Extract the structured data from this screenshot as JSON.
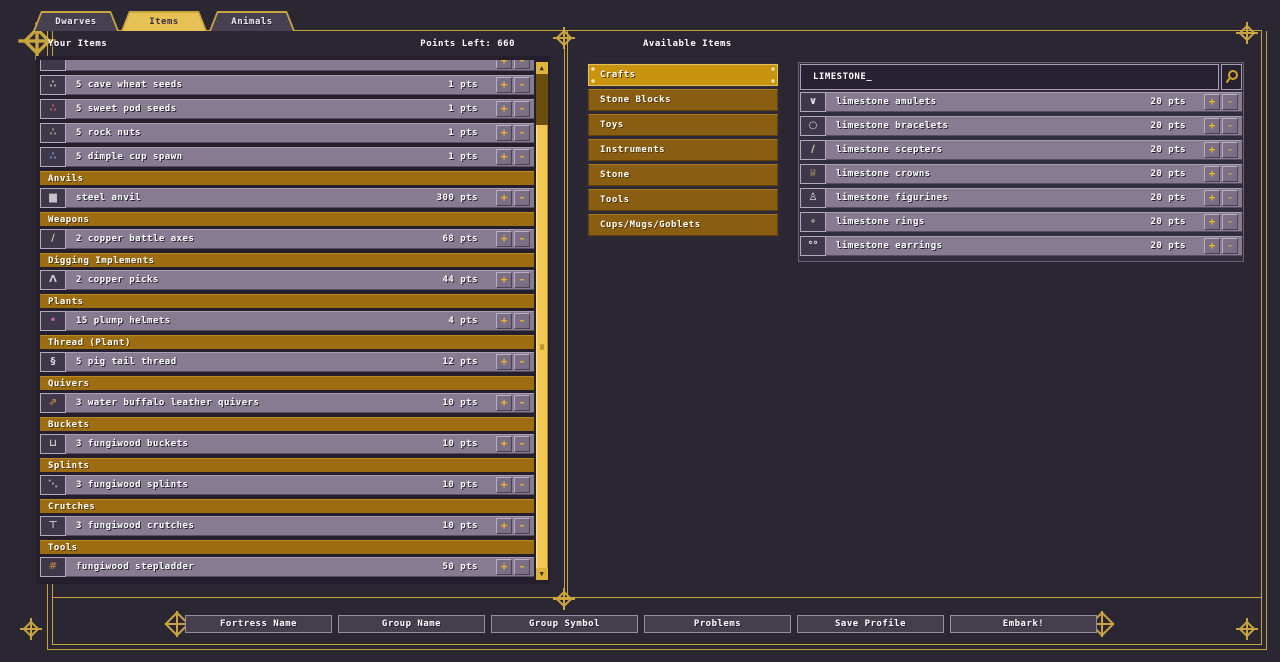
{
  "window": {
    "tabs": [
      {
        "label": "Dwarves",
        "active": false
      },
      {
        "label": "Items",
        "active": true
      },
      {
        "label": "Animals",
        "active": false
      }
    ]
  },
  "controls": {
    "increase_label": "+",
    "decrease_label": "-",
    "scroll_up": "▲",
    "scroll_down": "▼",
    "scroll_grip": "≡"
  },
  "colors": {
    "gold_frame": "#c9a540",
    "tab_active": "#e6c257",
    "section_header": "#9c6d11",
    "category": "#8a5e12",
    "category_selected": "#c8930e",
    "row": "#877b91",
    "button_glyph": "#f2b32c",
    "scroll_thumb": "#f0c853",
    "background": "#2b2732"
  },
  "left_panel": {
    "title": "Your Items",
    "points_left": "Points Left: 660",
    "list": [
      {
        "type": "item",
        "partial": true,
        "name": "",
        "pts": "",
        "icon": "",
        "icon_color": "#3f384a",
        "icon_name": "item-icon"
      },
      {
        "type": "item",
        "name": "5 cave wheat seeds",
        "pts": "1 pts",
        "icon": "∴",
        "icon_color": "#b9b1a4",
        "icon_name": "seeds-icon"
      },
      {
        "type": "item",
        "name": "5 sweet pod seeds",
        "pts": "1 pts",
        "icon": "∴",
        "icon_color": "#c25f5f",
        "icon_name": "seeds-icon"
      },
      {
        "type": "item",
        "name": "5 rock nuts",
        "pts": "1 pts",
        "icon": "∴",
        "icon_color": "#9aa37a",
        "icon_name": "seeds-icon"
      },
      {
        "type": "item",
        "name": "5 dimple cup spawn",
        "pts": "1 pts",
        "icon": "∴",
        "icon_color": "#6f8fd6",
        "icon_name": "spawn-icon"
      },
      {
        "type": "header",
        "label": "Anvils"
      },
      {
        "type": "item",
        "name": "steel anvil",
        "pts": "300 pts",
        "icon": "▆",
        "icon_color": "#c6c1cb",
        "icon_name": "anvil-icon"
      },
      {
        "type": "header",
        "label": "Weapons"
      },
      {
        "type": "item",
        "name": "2 copper battle axes",
        "pts": "68 pts",
        "icon": "∕",
        "icon_color": "#d8c49a",
        "icon_name": "battle-axe-icon"
      },
      {
        "type": "header",
        "label": "Digging Implements"
      },
      {
        "type": "item",
        "name": "2 copper picks",
        "pts": "44 pts",
        "icon": "Λ",
        "icon_color": "#cfc8d6",
        "icon_name": "pick-icon"
      },
      {
        "type": "header",
        "label": "Plants"
      },
      {
        "type": "item",
        "name": "15 plump helmets",
        "pts": "4 pts",
        "icon": "•",
        "icon_color": "#c964ba",
        "icon_name": "plump-helmet-icon"
      },
      {
        "type": "header",
        "label": "Thread (Plant)"
      },
      {
        "type": "item",
        "name": "5 pig tail thread",
        "pts": "12 pts",
        "icon": "§",
        "icon_color": "#dcd8e2",
        "icon_name": "thread-icon"
      },
      {
        "type": "header",
        "label": "Quivers"
      },
      {
        "type": "item",
        "name": "3 water buffalo leather quivers",
        "pts": "10 pts",
        "icon": "⇗",
        "icon_color": "#c08a4a",
        "icon_name": "quiver-icon"
      },
      {
        "type": "header",
        "label": "Buckets"
      },
      {
        "type": "item",
        "name": "3 fungiwood buckets",
        "pts": "10 pts",
        "icon": "⊔",
        "icon_color": "#d2cbb9",
        "icon_name": "bucket-icon"
      },
      {
        "type": "header",
        "label": "Splints"
      },
      {
        "type": "item",
        "name": "3 fungiwood splints",
        "pts": "10 pts",
        "icon": "⋱",
        "icon_color": "#b2a2c2",
        "icon_name": "splint-icon"
      },
      {
        "type": "header",
        "label": "Crutches"
      },
      {
        "type": "item",
        "name": "3 fungiwood crutches",
        "pts": "10 pts",
        "icon": "⊤",
        "icon_color": "#cac4d0",
        "icon_name": "crutch-icon"
      },
      {
        "type": "header",
        "label": "Tools"
      },
      {
        "type": "item",
        "name": "fungiwood stepladder",
        "pts": "50 pts",
        "icon": "#",
        "icon_color": "#b5793a",
        "icon_name": "stepladder-icon"
      }
    ]
  },
  "right_panel": {
    "title": "Available Items",
    "categories": [
      {
        "label": "Crafts",
        "selected": true
      },
      {
        "label": "Stone Blocks",
        "selected": false
      },
      {
        "label": "Toys",
        "selected": false
      },
      {
        "label": "Instruments",
        "selected": false
      },
      {
        "label": "Stone",
        "selected": false
      },
      {
        "label": "Tools",
        "selected": false
      },
      {
        "label": "Cups/Mugs/Goblets",
        "selected": false
      }
    ],
    "search": {
      "value": "LIMESTONE_",
      "icon_name": "search-icon"
    },
    "items": [
      {
        "name": "limestone amulets",
        "pts": "20 pts",
        "icon": "∨",
        "icon_color": "#eae6f0",
        "icon_name": "amulet-icon"
      },
      {
        "name": "limestone bracelets",
        "pts": "20 pts",
        "icon": "○",
        "icon_color": "#d9d3e2",
        "icon_name": "bracelet-icon"
      },
      {
        "name": "limestone scepters",
        "pts": "20 pts",
        "icon": "∕",
        "icon_color": "#e6d6a2",
        "icon_name": "scepter-icon"
      },
      {
        "name": "limestone crowns",
        "pts": "20 pts",
        "icon": "♕",
        "icon_color": "#cdb06a",
        "icon_name": "crown-icon"
      },
      {
        "name": "limestone figurines",
        "pts": "20 pts",
        "icon": "♙",
        "icon_color": "#e9e5ef",
        "icon_name": "figurine-icon"
      },
      {
        "name": "limestone rings",
        "pts": "20 pts",
        "icon": "∘",
        "icon_color": "#d6c9a0",
        "icon_name": "ring-icon"
      },
      {
        "name": "limestone earrings",
        "pts": "20 pts",
        "icon": "°°",
        "icon_color": "#e8e4ee",
        "icon_name": "earrings-icon"
      }
    ]
  },
  "footer": {
    "buttons": [
      {
        "label": "Fortress Name"
      },
      {
        "label": "Group Name"
      },
      {
        "label": "Group Symbol"
      },
      {
        "label": "Problems"
      },
      {
        "label": "Save Profile"
      },
      {
        "label": "Embark!"
      }
    ]
  }
}
